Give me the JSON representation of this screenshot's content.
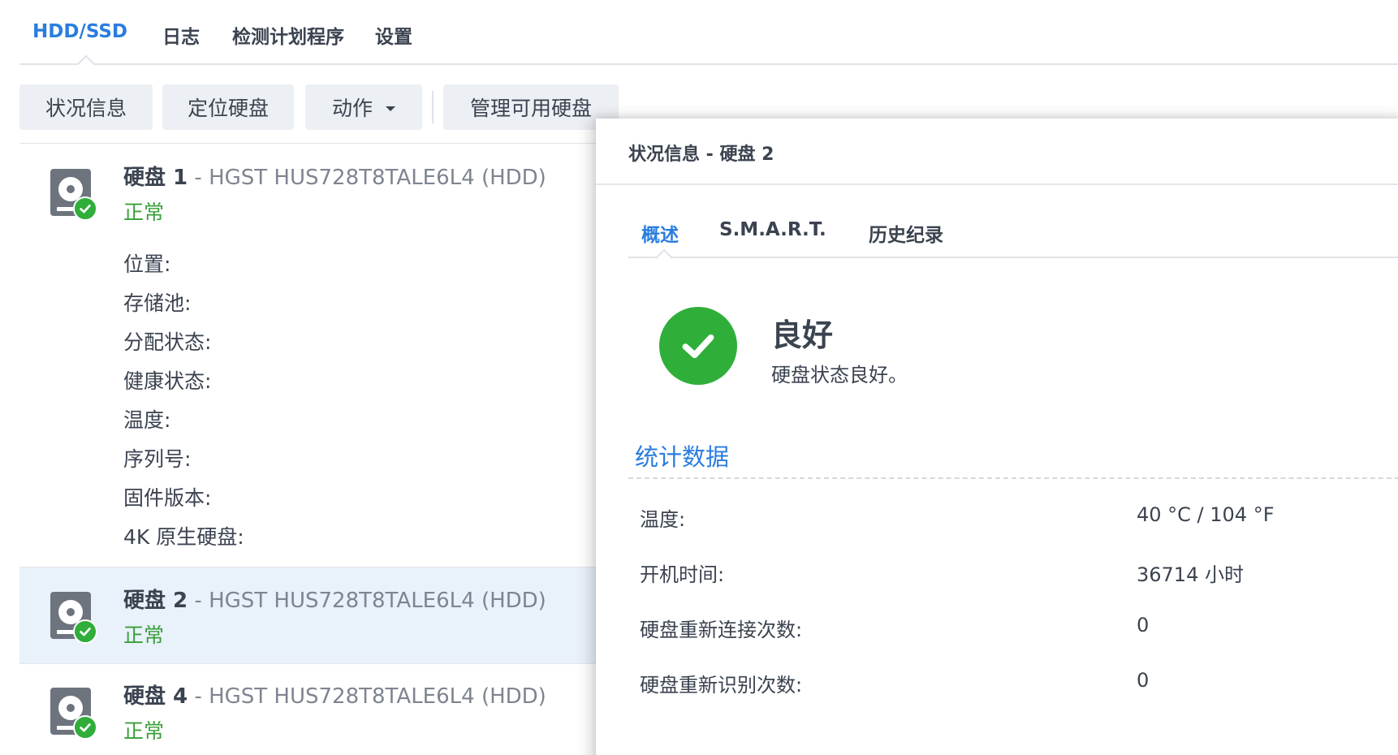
{
  "top_tabs": [
    {
      "label": "HDD/SSD",
      "active": true
    },
    {
      "label": "日志"
    },
    {
      "label": "检测计划程序"
    },
    {
      "label": "设置"
    }
  ],
  "toolbar": {
    "info_label": "状况信息",
    "locate_label": "定位硬盘",
    "action_label": "动作",
    "manage_label": "管理可用硬盘"
  },
  "disks": [
    {
      "name": "硬盘 1",
      "model": " - HGST HUS728T8TALE6L4 (HDD)",
      "status": "正常"
    },
    {
      "name": "硬盘 2",
      "model": " - HGST HUS728T8TALE6L4 (HDD)",
      "status": "正常"
    },
    {
      "name": "硬盘 4",
      "model": " - HGST HUS728T8TALE6L4 (HDD)",
      "status": "正常"
    }
  ],
  "disk1_props": [
    "位置:",
    "存储池:",
    "分配状态:",
    "健康状态:",
    "温度:",
    "序列号:",
    "固件版本:",
    "4K 原生硬盘:"
  ],
  "panel": {
    "title": "状况信息 - 硬盘 2",
    "tabs": [
      {
        "label": "概述",
        "active": true
      },
      {
        "label": "S.M.A.R.T."
      },
      {
        "label": "历史纪录"
      }
    ],
    "health_title": "良好",
    "health_desc": "硬盘状态良好。",
    "stats_title": "统计数据",
    "stats": [
      {
        "label": "温度:",
        "value": "40 °C / 104 °F"
      },
      {
        "label": "开机时间:",
        "value": "36714 小时"
      },
      {
        "label": "硬盘重新连接次数:",
        "value": "0"
      },
      {
        "label": "硬盘重新识别次数:",
        "value": "0"
      }
    ]
  },
  "colors": {
    "accent": "#2a7de0",
    "ok": "#2fae3a",
    "status_text": "#3aa03a",
    "selected_row": "#e9f1fb"
  }
}
